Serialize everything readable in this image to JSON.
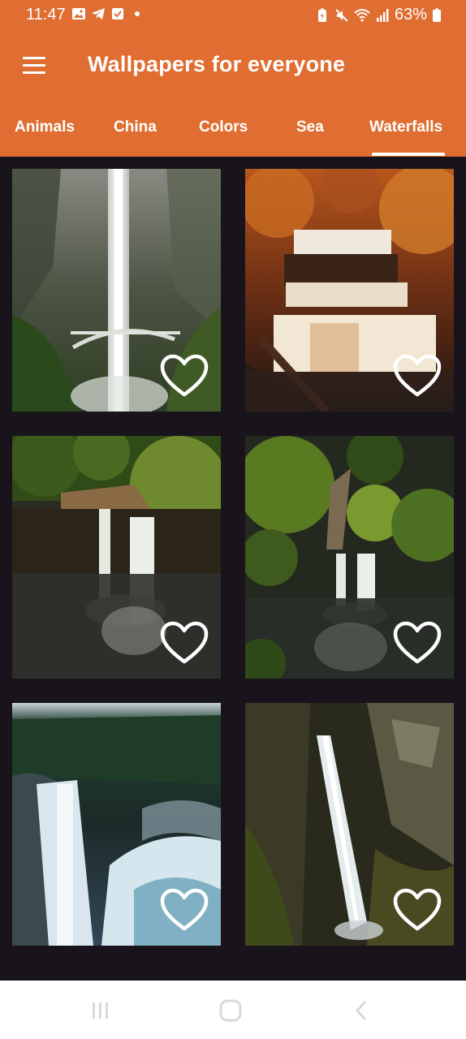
{
  "status_bar": {
    "time": "11:47",
    "battery": "63%"
  },
  "app_bar": {
    "title": "Wallpapers for everyone"
  },
  "tabs": [
    {
      "label": "Animals"
    },
    {
      "label": "China"
    },
    {
      "label": "Colors"
    },
    {
      "label": "Sea"
    },
    {
      "label": "Waterfalls"
    }
  ],
  "selected_tab": "Waterfalls",
  "colors": {
    "accent": "#e06e32",
    "background": "#19141c"
  },
  "wallpapers": [
    {
      "theme": "misty-tall-waterfall-bridge",
      "favorite": false
    },
    {
      "theme": "autumn-cascade",
      "favorite": false
    },
    {
      "theme": "twin-falls-forest-aerial",
      "favorite": false
    },
    {
      "theme": "twin-falls-green-aerial",
      "favorite": false
    },
    {
      "theme": "snowy-forest-waterfall",
      "favorite": false
    },
    {
      "theme": "mossy-cliff-waterfall",
      "favorite": false
    }
  ]
}
